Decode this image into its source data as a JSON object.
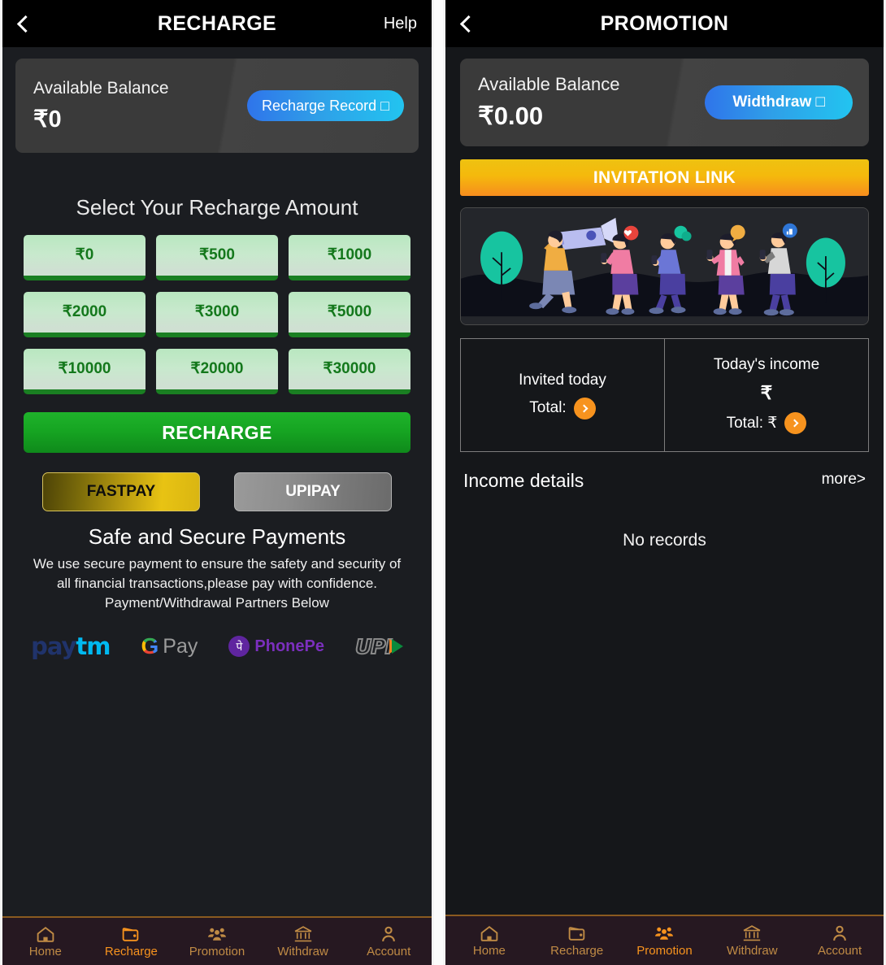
{
  "left": {
    "topbar": {
      "title": "RECHARGE",
      "back_icon": "chevron-left-icon",
      "help": "Help"
    },
    "balance": {
      "label": "Available Balance",
      "amount": "₹0",
      "action_label": "Recharge Record □"
    },
    "select_title": "Select Your Recharge Amount",
    "amounts": [
      "₹0",
      "₹500",
      "₹1000",
      "₹2000",
      "₹3000",
      "₹5000",
      "₹10000",
      "₹20000",
      "₹30000"
    ],
    "recharge_button": "RECHARGE",
    "pay_methods": [
      {
        "label": "FASTPAY",
        "style": "gold"
      },
      {
        "label": "UPIPAY",
        "style": "silver"
      }
    ],
    "safe_title": "Safe and Secure Payments",
    "safe_line1": "We use secure payment to ensure the safety and security of",
    "safe_line2": "all financial transactions,please pay with confidence.",
    "safe_line3": "Payment/Withdrawal Partners Below",
    "partners": [
      {
        "name": "paytm",
        "part1": "pay",
        "part2": "tm"
      },
      {
        "name": "google-pay",
        "g": "G",
        "pay": "Pay"
      },
      {
        "name": "phonepe",
        "glyph": "पे",
        "text": "PhonePe"
      },
      {
        "name": "upi",
        "text": "UPI"
      }
    ]
  },
  "right": {
    "topbar": {
      "title": "PROMOTION",
      "back_icon": "chevron-left-icon"
    },
    "balance": {
      "label": "Available Balance",
      "amount": "₹0.00",
      "action_label": "Widthdraw □"
    },
    "invitation_button": "INVITATION LINK",
    "illustration_name": "people-megaphone-referral-illustration",
    "stats": [
      {
        "label": "Invited today",
        "rupee": "",
        "total_label": "Total:"
      },
      {
        "label": "Today's income",
        "rupee": "₹",
        "total_label": "Total: ₹"
      }
    ],
    "income": {
      "title": "Income details",
      "more": "more>",
      "empty": "No records"
    }
  },
  "bottom_nav": {
    "left_active": "Recharge",
    "right_active": "Promotion",
    "items": [
      {
        "label": "Home",
        "icon": "home-icon"
      },
      {
        "label": "Recharge",
        "icon": "wallet-icon"
      },
      {
        "label": "Promotion",
        "icon": "people-icon"
      },
      {
        "label": "Withdraw",
        "icon": "bank-icon"
      },
      {
        "label": "Account",
        "icon": "person-icon"
      }
    ]
  },
  "colors": {
    "nav_bg": "#261821",
    "nav_active": "#f7931e",
    "nav_inactive": "#c08b45",
    "accent_blue": "#2f9fe8",
    "accent_green": "#16a522",
    "accent_gold": "#f5b90c",
    "panel_bg": "#1b1d21"
  }
}
